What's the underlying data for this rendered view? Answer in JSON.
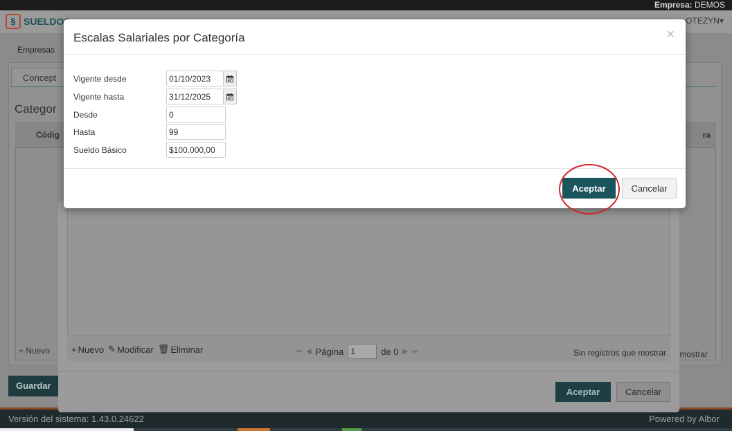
{
  "app": {
    "brand": "SUELDOS",
    "empresa_label": "Empresa:",
    "empresa_value": "DEMOS",
    "user": "OTEZYN▾",
    "breadcrumb": "Empresas",
    "tab": "Concept",
    "section_title": "Categor",
    "grid_col_first": "Códig",
    "grid_col_last": "ra",
    "nuevo": "+ Nuevo",
    "mostrar": "mostrar",
    "guardar": "Guardar",
    "version": "Versión del sistema: 1.43.0.24622",
    "powered": "Powered by Albor"
  },
  "underlying_dialog": {
    "actions": {
      "new": "Nuevo",
      "edit": "Modificar",
      "delete": "Eliminar"
    },
    "pager": {
      "page_label": "Página",
      "page_value": "1",
      "of_label": "de 0",
      "no_records": "Sin registros que mostrar"
    },
    "accept": "Aceptar",
    "cancel": "Cancelar"
  },
  "modal": {
    "title": "Escalas Salariales por Categoría",
    "close": "×",
    "fields": {
      "vigente_desde": {
        "label": "Vigente desde",
        "value": "01/10/2023"
      },
      "vigente_hasta": {
        "label": "Vigente hasta",
        "value": "31/12/2025"
      },
      "desde": {
        "label": "Desde",
        "value": "0"
      },
      "hasta": {
        "label": "Hasta",
        "value": "99"
      },
      "sueldo_basico": {
        "label": "Sueldo Básico",
        "value": "$100.000,00"
      }
    },
    "accept": "Aceptar",
    "cancel": "Cancelar"
  },
  "colors": {
    "accent": "#1a555c",
    "highlight": "#d0232a"
  }
}
